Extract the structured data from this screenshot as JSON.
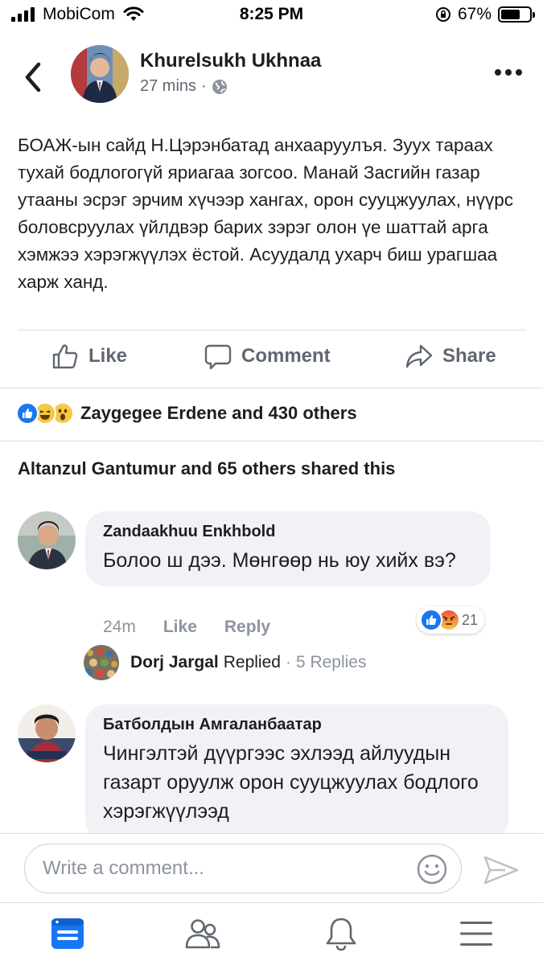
{
  "status_bar": {
    "carrier": "MobiCom",
    "time": "8:25 PM",
    "battery": "67%",
    "battery_level": 0.67
  },
  "post": {
    "author": "Khurelsukh Ukhnaa",
    "time": "27 mins",
    "separator": "·",
    "text": "БОАЖ-ын сайд Н.Цэрэнбатад анхааруулъя. Зуух тараах тухай бодлогогүй яриагаа зогсоо. Манай Засгийн газар утааны эсрэг эрчим хүчээр хангах, орон сууцжуулах, нүүрс боловсруулах үйлдвэр барих зэрэг олон үе шаттай арга хэмжээ хэрэгжүүлэх ёстой. Асуудалд ухарч биш урагшаа харж ханд."
  },
  "actions": {
    "like": "Like",
    "comment": "Comment",
    "share": "Share"
  },
  "reactions": {
    "summary": "Zaygegee Erdene and 430 others",
    "types": [
      "like",
      "haha",
      "wow"
    ]
  },
  "shares": {
    "summary": "Altanzul Gantumur and 65 others shared this"
  },
  "comments": [
    {
      "author": "Zandaakhuu Enkhbold",
      "text": "Болоо ш дээ. Мөнгөөр нь юу хийх вэ?",
      "time": "24m",
      "like_label": "Like",
      "reply_label": "Reply",
      "reaction_count": "21",
      "reaction_types": [
        "like",
        "angry"
      ],
      "reply_preview": {
        "name": "Dorj Jargal",
        "action": "Replied",
        "separator": "·",
        "count": "5 Replies"
      }
    },
    {
      "author": "Батболдын Амгаланбаатар",
      "text": "Чингэлтэй дүүргээс эхлээд айлуудын газарт оруулж орон сууцжуулах бодлого хэрэгжүүлээд"
    }
  ],
  "composer": {
    "placeholder": "Write a comment..."
  },
  "colors": {
    "fb_blue": "#1877f2",
    "text_primary": "#1c1e21",
    "text_secondary": "#606770",
    "bubble_bg": "#f0f2f5",
    "divider": "#dadde1"
  },
  "icons": {
    "back": "chevron-left-icon",
    "globe": "globe-icon",
    "more": "more-dots-icon",
    "like": "thumbs-up-icon",
    "comment": "speech-bubble-icon",
    "share": "share-arrow-icon",
    "emoji": "smiley-icon",
    "send": "send-icon",
    "nav": [
      "news-feed-icon",
      "friends-icon",
      "notifications-bell-icon",
      "menu-icon"
    ]
  }
}
